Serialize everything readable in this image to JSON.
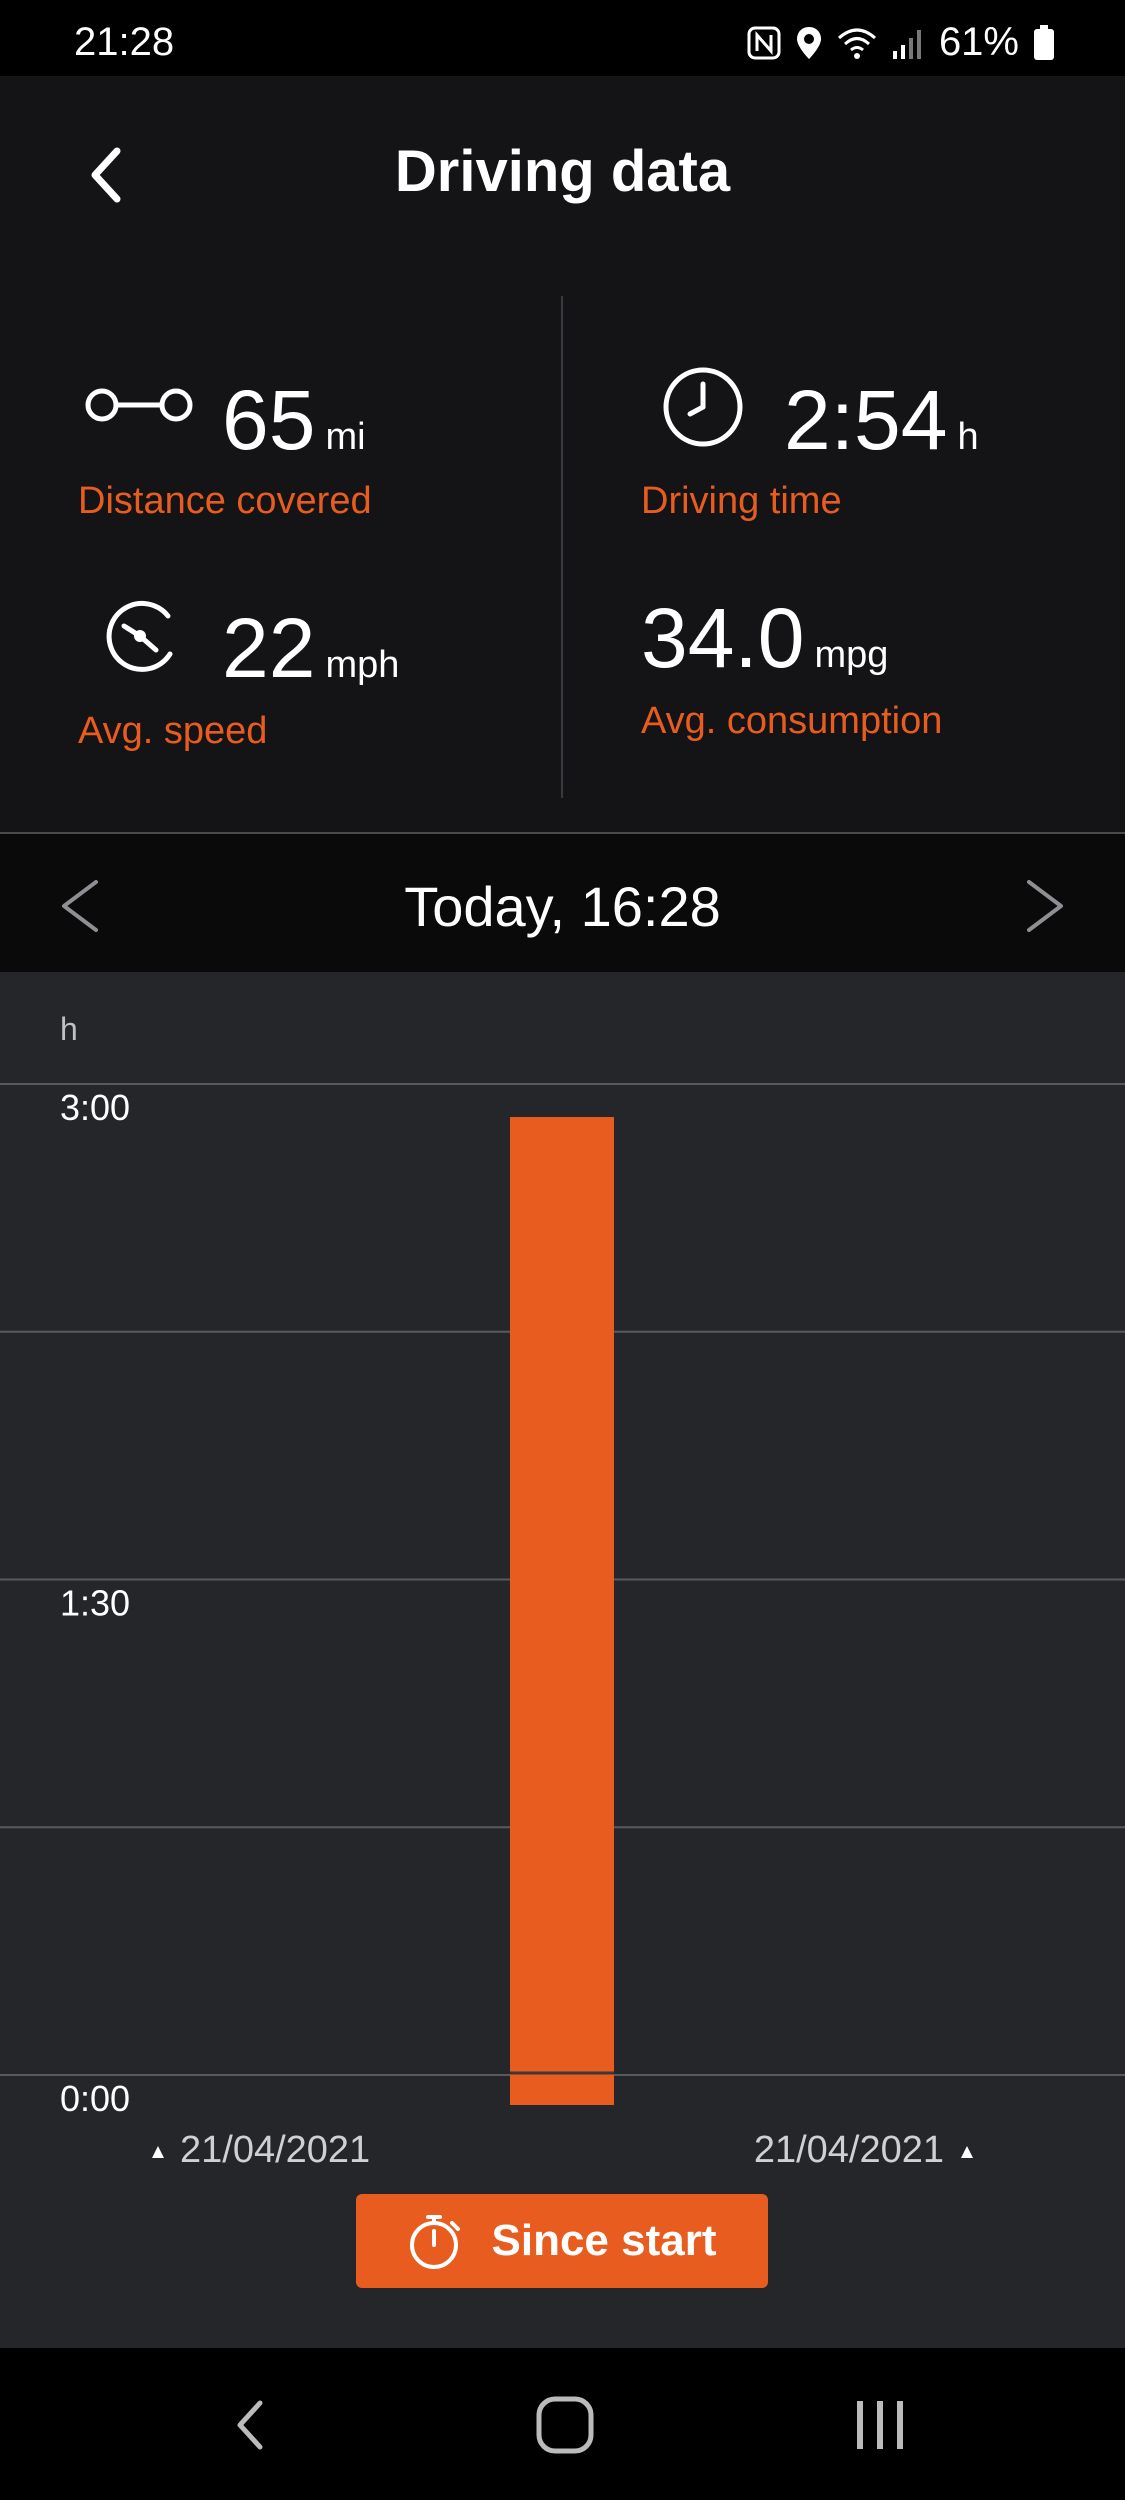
{
  "status_bar": {
    "time": "21:28",
    "battery": "61%",
    "icons": [
      "nfc-icon",
      "location-icon",
      "wifi-icon",
      "signal-icon",
      "battery-icon"
    ]
  },
  "header": {
    "title": "Driving data",
    "back_icon": "chevron-left-icon"
  },
  "stats": {
    "distance": {
      "value": "65",
      "unit": "mi",
      "label": "Distance covered",
      "icon": "route-icon"
    },
    "driving_time": {
      "value": "2:54",
      "unit": "h",
      "label": "Driving time",
      "icon": "clock-icon"
    },
    "avg_speed": {
      "value": "22",
      "unit": "mph",
      "label": "Avg. speed",
      "icon": "speedometer-icon"
    },
    "avg_consumption": {
      "value": "34.0",
      "unit": "mpg",
      "label": "Avg. consumption"
    }
  },
  "date_nav": {
    "label": "Today, 16:28",
    "prev_icon": "chevron-left-icon",
    "next_icon": "chevron-right-icon"
  },
  "chart_data": {
    "type": "bar",
    "ylabel": "h",
    "ytick_labels": [
      "3:00",
      "1:30",
      "0:00"
    ],
    "ylim": [
      0,
      3
    ],
    "grid": true,
    "categories": [
      "21/04/2021"
    ],
    "values": [
      2.9
    ],
    "x_labels": [
      "21/04/2021",
      "21/04/2021"
    ],
    "bar_color": "#e85d1f"
  },
  "since_start": {
    "label": "Since start",
    "icon": "stopwatch-icon"
  },
  "nav_bar": {
    "icons": [
      "back-icon",
      "home-icon",
      "recents-icon"
    ]
  },
  "colors": {
    "accent": "#e85d1f",
    "header_bg": "#141416",
    "chart_bg": "#252629"
  }
}
